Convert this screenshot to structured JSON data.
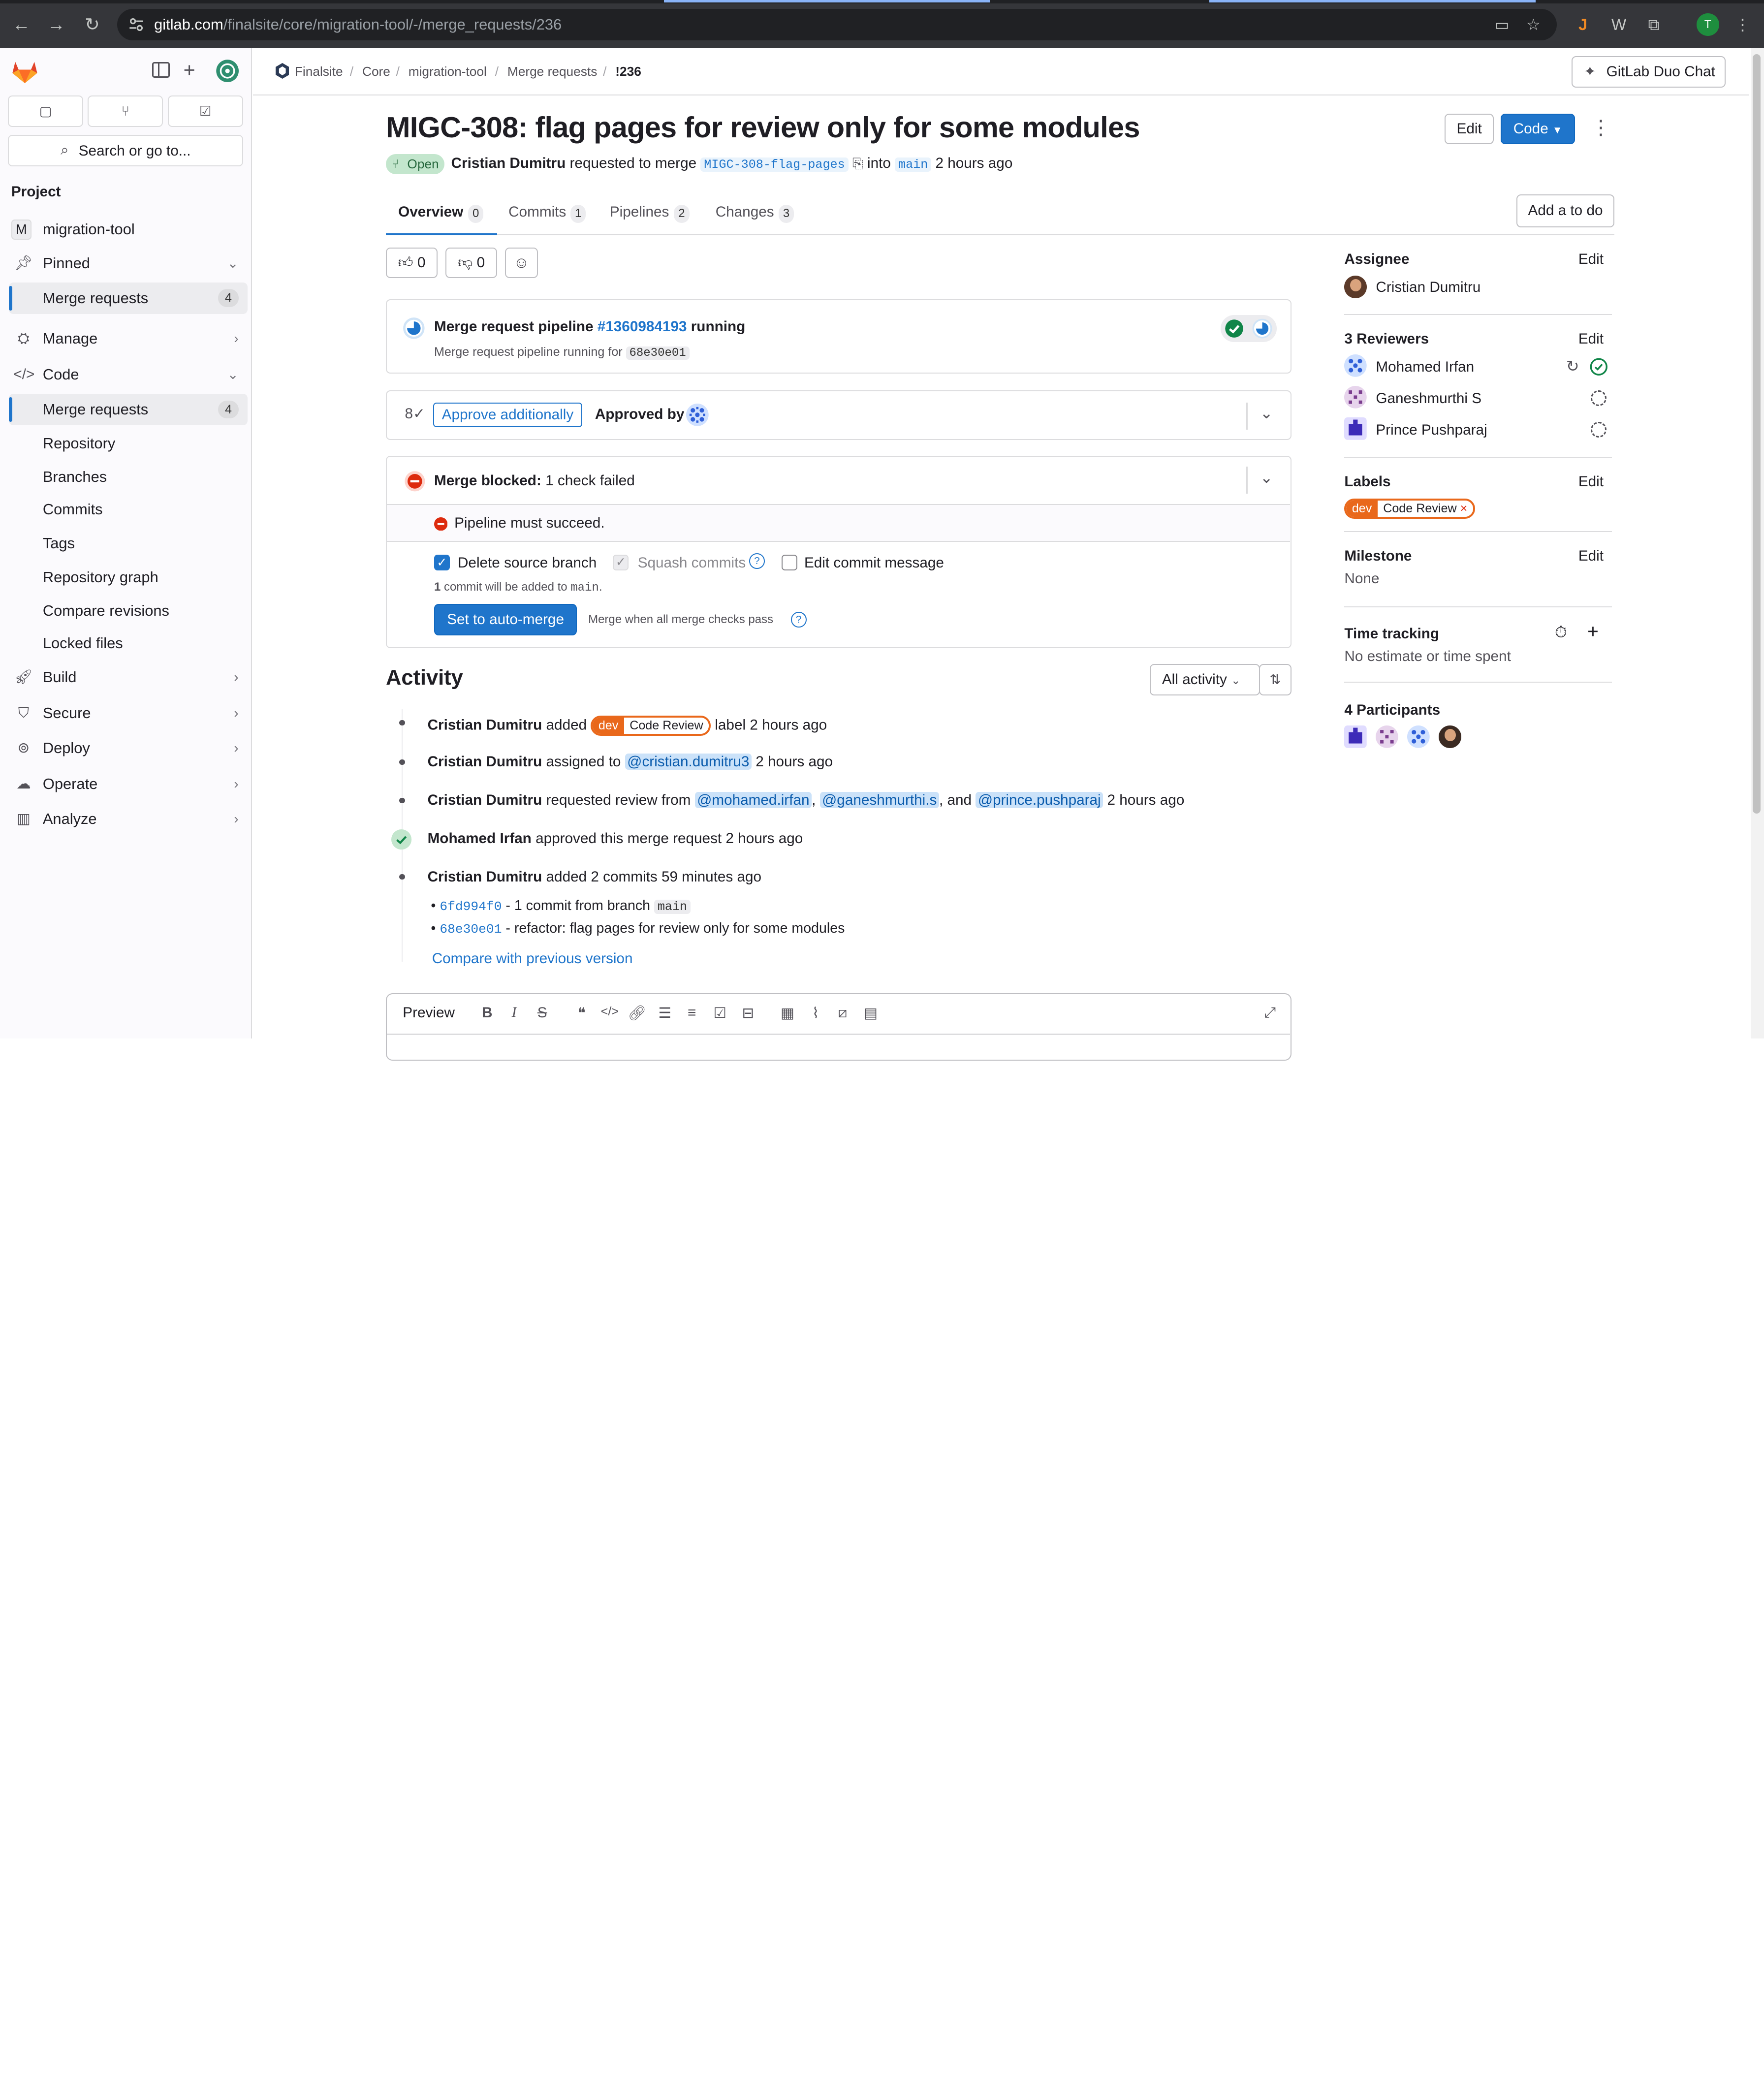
{
  "browser": {
    "url_host": "gitlab.com",
    "url_path": "/finalsite/core/migration-tool/-/merge_requests/236",
    "profile_initial": "T"
  },
  "sidebar": {
    "search_placeholder": "Search or go to...",
    "section_title": "Project",
    "project_initial": "M",
    "project_name": "migration-tool",
    "pinned": "Pinned",
    "pinned_items": [
      {
        "label": "Merge requests",
        "count": "4"
      }
    ],
    "manage": "Manage",
    "code": "Code",
    "code_items": [
      {
        "label": "Merge requests",
        "count": "4"
      },
      {
        "label": "Repository"
      },
      {
        "label": "Branches"
      },
      {
        "label": "Commits"
      },
      {
        "label": "Tags"
      },
      {
        "label": "Repository graph"
      },
      {
        "label": "Compare revisions"
      },
      {
        "label": "Locked files"
      }
    ],
    "build": "Build",
    "secure": "Secure",
    "deploy": "Deploy",
    "operate": "Operate",
    "analyze": "Analyze"
  },
  "breadcrumb": [
    "Finalsite",
    "Core",
    "migration-tool",
    "Merge requests",
    "!236"
  ],
  "duo_button": "GitLab Duo Chat",
  "mr": {
    "title": "MIGC-308: flag pages for review only for some modules",
    "status": "Open",
    "author": "Cristian Dumitru",
    "requested_text": "requested to merge",
    "source_branch": "MIGC-308-flag-pages",
    "into_text": "into",
    "target_branch": "main",
    "time": "2 hours ago",
    "edit_label": "Edit",
    "code_label": "Code"
  },
  "tabs": [
    {
      "label": "Overview",
      "count": "0"
    },
    {
      "label": "Commits",
      "count": "1"
    },
    {
      "label": "Pipelines",
      "count": "2"
    },
    {
      "label": "Changes",
      "count": "3"
    }
  ],
  "add_todo": "Add a to do",
  "reactions": {
    "thumbs_up": "0",
    "thumbs_down": "0"
  },
  "pipeline": {
    "title_prefix": "Merge request pipeline",
    "id": "#1360984193",
    "status": "running",
    "subtitle": "Merge request pipeline running for",
    "sha": "68e30e01"
  },
  "approval": {
    "button": "Approve additionally",
    "approved_by": "Approved by"
  },
  "merge": {
    "blocked_title": "Merge blocked:",
    "blocked_detail": "1 check failed",
    "check_failed": "Pipeline must succeed.",
    "delete_source": "Delete source branch",
    "squash": "Squash commits",
    "edit_message": "Edit commit message",
    "commit_info_count": "1",
    "commit_info_text": "commit will be added to",
    "commit_info_branch": "main",
    "commit_info_end": ".",
    "auto_merge": "Set to auto-merge",
    "merge_when": "Merge when all merge checks pass"
  },
  "activity": {
    "title": "Activity",
    "filter": "All activity",
    "items": [
      {
        "actor": "Cristian Dumitru",
        "text1": "added",
        "label_scope": "dev",
        "label_value": "Code Review",
        "text2": "label 2 hours ago"
      },
      {
        "actor": "Cristian Dumitru",
        "text1": "assigned to",
        "mention": "@cristian.dumitru3",
        "text2": "2 hours ago"
      },
      {
        "actor": "Cristian Dumitru",
        "text1": "requested review from",
        "mentions": [
          "@mohamed.irfan",
          "@ganeshmurthi.s",
          "@prince.pushparaj"
        ],
        "sep1": ",",
        "sep2": ", and",
        "text2": "2 hours ago"
      },
      {
        "actor": "Mohamed Irfan",
        "text1": "approved this merge request 2 hours ago"
      },
      {
        "actor": "Cristian Dumitru",
        "text1": "added 2 commits 59 minutes ago"
      }
    ],
    "commits": [
      {
        "sha": "6fd994f0",
        "text": "- 1 commit from branch",
        "branch": "main"
      },
      {
        "sha": "68e30e01",
        "text": "- refactor: flag pages for review only for some modules"
      }
    ],
    "compare": "Compare with previous version"
  },
  "editor": {
    "preview": "Preview"
  },
  "right_sidebar": {
    "assignee_title": "Assignee",
    "assignee": "Cristian Dumitru",
    "reviewers_title": "3 Reviewers",
    "reviewers": [
      "Mohamed Irfan",
      "Ganeshmurthi S",
      "Prince Pushparaj"
    ],
    "labels_title": "Labels",
    "label_scope": "dev",
    "label_value": "Code Review",
    "milestone_title": "Milestone",
    "milestone": "None",
    "time_title": "Time tracking",
    "time_value": "No estimate or time spent",
    "participants_title": "4 Participants",
    "edit": "Edit"
  },
  "colors": {
    "primary": "#1f75cb",
    "success": "#108548",
    "danger": "#dd2b0e",
    "label": "#e9681b"
  }
}
